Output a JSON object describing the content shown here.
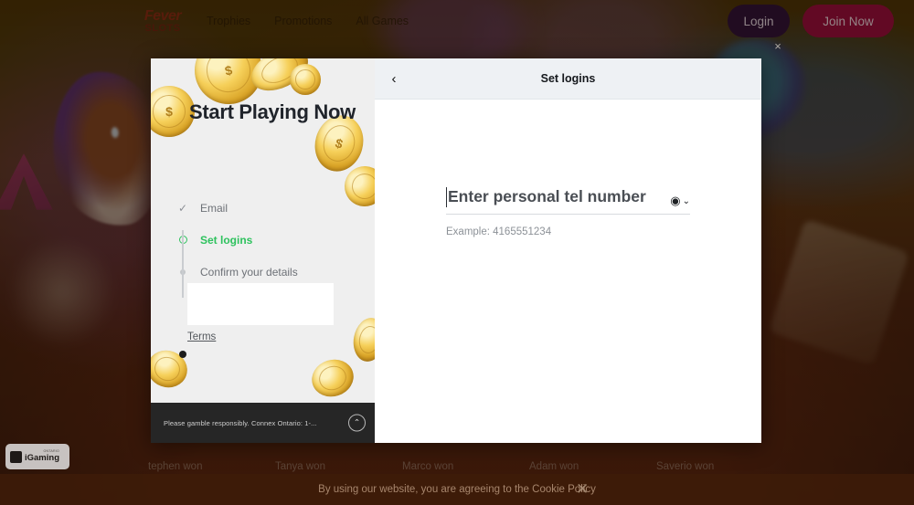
{
  "site": {
    "logo": {
      "line1": "Fever",
      "line2": "SLOTS"
    },
    "nav": [
      {
        "label": "Trophies"
      },
      {
        "label": "Promotions"
      },
      {
        "label": "All Games"
      }
    ],
    "login_button": "Login",
    "join_button": "Join Now",
    "close_icon": "×"
  },
  "modal": {
    "left": {
      "title": "Start Playing Now",
      "steps": [
        {
          "label": "Email",
          "state": "completed",
          "marker": "check-icon"
        },
        {
          "label": "Set logins",
          "state": "active",
          "marker": "ring-icon"
        },
        {
          "label": "Confirm your details",
          "state": "pending",
          "marker": "small-dot-icon"
        }
      ],
      "terms_link": "Terms",
      "footer_text": "Please gamble responsibly. Connex Ontario: 1-...",
      "scroll_top_icon": "⌃"
    },
    "right": {
      "title": "Set logins",
      "back_icon": "‹",
      "tel_placeholder": "Enter personal tel number",
      "tel_value": "",
      "contacts_icon": "◉",
      "contacts_chevron": "⌄",
      "hint": "Example: 4165551234"
    }
  },
  "winners": [
    {
      "label": "tephen won"
    },
    {
      "label": "Tanya won"
    },
    {
      "label": "Marco won"
    },
    {
      "label": "Adam won"
    },
    {
      "label": "Saverio won"
    }
  ],
  "igaming": {
    "top": "ONTARIO",
    "name": "iGaming"
  },
  "cookie": {
    "text": "By using our website, you are agreeing to the Cookie Policy",
    "close_icon": "✕"
  },
  "colors": {
    "accent_green": "#2ec25e",
    "join_button": "#9c0b3f",
    "login_button": "#2b1039",
    "panel_header": "#eef1f4"
  }
}
